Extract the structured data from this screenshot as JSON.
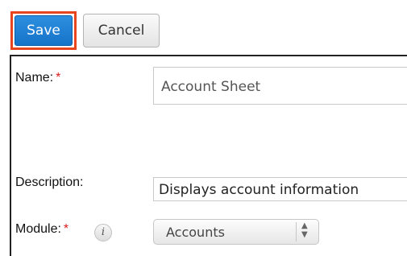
{
  "toolbar": {
    "save_label": "Save",
    "cancel_label": "Cancel"
  },
  "form": {
    "name": {
      "label": "Name:",
      "required_marker": "*",
      "value": "Account Sheet"
    },
    "description": {
      "label": "Description:",
      "value": "Displays account information"
    },
    "module": {
      "label": "Module:",
      "required_marker": "*",
      "info_icon_glyph": "i",
      "selected": "Accounts",
      "arrow_up": "▲",
      "arrow_down": "▼"
    }
  },
  "colors": {
    "primary_button": "#1a78cc",
    "highlight_border": "#e8451e",
    "required_marker": "#d71c1c"
  },
  "icons": {
    "info": "info-icon",
    "select_arrows": "select-arrows-icon"
  }
}
